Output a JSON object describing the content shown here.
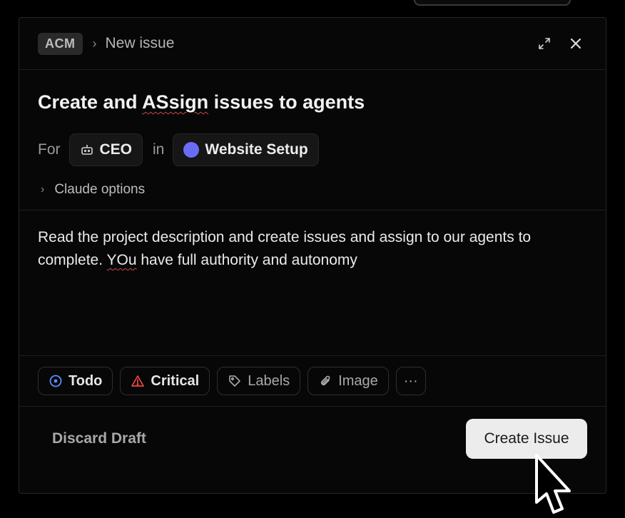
{
  "header": {
    "project_badge": "ACM",
    "crumb_separator": "›",
    "crumb_current": "New issue",
    "expand_icon": "expand-icon",
    "close_icon": "close-icon"
  },
  "issue": {
    "title_part1": "Create and ",
    "title_misspelled": "ASsign",
    "title_part2": " issues to agents",
    "for_label": "For",
    "assignee": "CEO",
    "in_label": "in",
    "project": "Website Setup",
    "project_color": "#6b6cf6",
    "options_label": "Claude options",
    "description_part1": "Read the project description and create issues and assign to our agents to complete. ",
    "description_misspelled": "YOu",
    "description_part2": " have full authority and autonomy"
  },
  "toolbar": {
    "status_label": "Todo",
    "status_color": "#5b8cff",
    "priority_label": "Critical",
    "priority_color": "#ef4444",
    "labels_label": "Labels",
    "image_label": "Image",
    "more_label": "···"
  },
  "footer": {
    "discard_label": "Discard Draft",
    "create_label": "Create Issue"
  }
}
